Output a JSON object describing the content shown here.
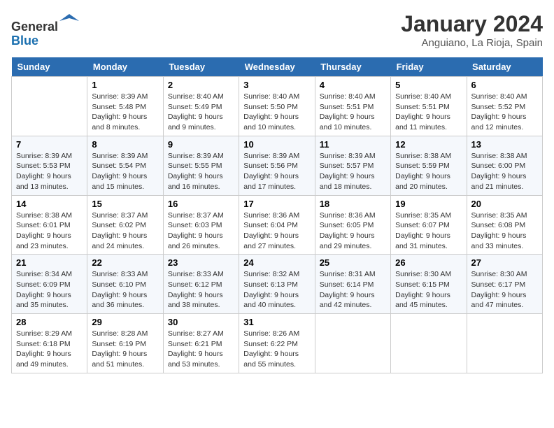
{
  "header": {
    "logo_line1": "General",
    "logo_line2": "Blue",
    "month_year": "January 2024",
    "location": "Anguiano, La Rioja, Spain"
  },
  "weekdays": [
    "Sunday",
    "Monday",
    "Tuesday",
    "Wednesday",
    "Thursday",
    "Friday",
    "Saturday"
  ],
  "weeks": [
    [
      {
        "day": "",
        "detail": ""
      },
      {
        "day": "1",
        "detail": "Sunrise: 8:39 AM\nSunset: 5:48 PM\nDaylight: 9 hours\nand 8 minutes."
      },
      {
        "day": "2",
        "detail": "Sunrise: 8:40 AM\nSunset: 5:49 PM\nDaylight: 9 hours\nand 9 minutes."
      },
      {
        "day": "3",
        "detail": "Sunrise: 8:40 AM\nSunset: 5:50 PM\nDaylight: 9 hours\nand 10 minutes."
      },
      {
        "day": "4",
        "detail": "Sunrise: 8:40 AM\nSunset: 5:51 PM\nDaylight: 9 hours\nand 10 minutes."
      },
      {
        "day": "5",
        "detail": "Sunrise: 8:40 AM\nSunset: 5:51 PM\nDaylight: 9 hours\nand 11 minutes."
      },
      {
        "day": "6",
        "detail": "Sunrise: 8:40 AM\nSunset: 5:52 PM\nDaylight: 9 hours\nand 12 minutes."
      }
    ],
    [
      {
        "day": "7",
        "detail": "Sunrise: 8:39 AM\nSunset: 5:53 PM\nDaylight: 9 hours\nand 13 minutes."
      },
      {
        "day": "8",
        "detail": "Sunrise: 8:39 AM\nSunset: 5:54 PM\nDaylight: 9 hours\nand 15 minutes."
      },
      {
        "day": "9",
        "detail": "Sunrise: 8:39 AM\nSunset: 5:55 PM\nDaylight: 9 hours\nand 16 minutes."
      },
      {
        "day": "10",
        "detail": "Sunrise: 8:39 AM\nSunset: 5:56 PM\nDaylight: 9 hours\nand 17 minutes."
      },
      {
        "day": "11",
        "detail": "Sunrise: 8:39 AM\nSunset: 5:57 PM\nDaylight: 9 hours\nand 18 minutes."
      },
      {
        "day": "12",
        "detail": "Sunrise: 8:38 AM\nSunset: 5:59 PM\nDaylight: 9 hours\nand 20 minutes."
      },
      {
        "day": "13",
        "detail": "Sunrise: 8:38 AM\nSunset: 6:00 PM\nDaylight: 9 hours\nand 21 minutes."
      }
    ],
    [
      {
        "day": "14",
        "detail": "Sunrise: 8:38 AM\nSunset: 6:01 PM\nDaylight: 9 hours\nand 23 minutes."
      },
      {
        "day": "15",
        "detail": "Sunrise: 8:37 AM\nSunset: 6:02 PM\nDaylight: 9 hours\nand 24 minutes."
      },
      {
        "day": "16",
        "detail": "Sunrise: 8:37 AM\nSunset: 6:03 PM\nDaylight: 9 hours\nand 26 minutes."
      },
      {
        "day": "17",
        "detail": "Sunrise: 8:36 AM\nSunset: 6:04 PM\nDaylight: 9 hours\nand 27 minutes."
      },
      {
        "day": "18",
        "detail": "Sunrise: 8:36 AM\nSunset: 6:05 PM\nDaylight: 9 hours\nand 29 minutes."
      },
      {
        "day": "19",
        "detail": "Sunrise: 8:35 AM\nSunset: 6:07 PM\nDaylight: 9 hours\nand 31 minutes."
      },
      {
        "day": "20",
        "detail": "Sunrise: 8:35 AM\nSunset: 6:08 PM\nDaylight: 9 hours\nand 33 minutes."
      }
    ],
    [
      {
        "day": "21",
        "detail": "Sunrise: 8:34 AM\nSunset: 6:09 PM\nDaylight: 9 hours\nand 35 minutes."
      },
      {
        "day": "22",
        "detail": "Sunrise: 8:33 AM\nSunset: 6:10 PM\nDaylight: 9 hours\nand 36 minutes."
      },
      {
        "day": "23",
        "detail": "Sunrise: 8:33 AM\nSunset: 6:12 PM\nDaylight: 9 hours\nand 38 minutes."
      },
      {
        "day": "24",
        "detail": "Sunrise: 8:32 AM\nSunset: 6:13 PM\nDaylight: 9 hours\nand 40 minutes."
      },
      {
        "day": "25",
        "detail": "Sunrise: 8:31 AM\nSunset: 6:14 PM\nDaylight: 9 hours\nand 42 minutes."
      },
      {
        "day": "26",
        "detail": "Sunrise: 8:30 AM\nSunset: 6:15 PM\nDaylight: 9 hours\nand 45 minutes."
      },
      {
        "day": "27",
        "detail": "Sunrise: 8:30 AM\nSunset: 6:17 PM\nDaylight: 9 hours\nand 47 minutes."
      }
    ],
    [
      {
        "day": "28",
        "detail": "Sunrise: 8:29 AM\nSunset: 6:18 PM\nDaylight: 9 hours\nand 49 minutes."
      },
      {
        "day": "29",
        "detail": "Sunrise: 8:28 AM\nSunset: 6:19 PM\nDaylight: 9 hours\nand 51 minutes."
      },
      {
        "day": "30",
        "detail": "Sunrise: 8:27 AM\nSunset: 6:21 PM\nDaylight: 9 hours\nand 53 minutes."
      },
      {
        "day": "31",
        "detail": "Sunrise: 8:26 AM\nSunset: 6:22 PM\nDaylight: 9 hours\nand 55 minutes."
      },
      {
        "day": "",
        "detail": ""
      },
      {
        "day": "",
        "detail": ""
      },
      {
        "day": "",
        "detail": ""
      }
    ]
  ]
}
